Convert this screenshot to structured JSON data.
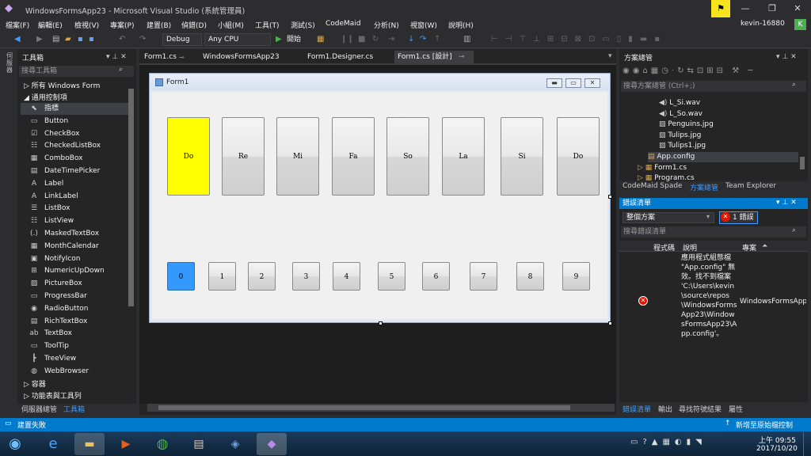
{
  "window": {
    "title": "WindowsFormsApp23 - Microsoft Visual Studio (系統管理員)",
    "user": "kevin-16880",
    "user_badge": "K"
  },
  "menu": [
    "檔案(F)",
    "編輯(E)",
    "檢視(V)",
    "專案(P)",
    "建置(B)",
    "偵錯(D)",
    "小組(M)",
    "工具(T)",
    "測試(S)",
    "CodeMaid",
    "分析(N)",
    "視窗(W)",
    "說明(H)"
  ],
  "toolbar": {
    "config": "Debug",
    "platform": "Any CPU",
    "start": "開始"
  },
  "toolbox": {
    "title": "工具箱",
    "search": "搜尋工具箱",
    "group_all": "所有 Windows Form",
    "group_common": "通用控制項",
    "items": [
      "指標",
      "Button",
      "CheckBox",
      "CheckedListBox",
      "ComboBox",
      "DateTimePicker",
      "Label",
      "LinkLabel",
      "ListBox",
      "ListView",
      "MaskedTextBox",
      "MonthCalendar",
      "NotifyIcon",
      "NumericUpDown",
      "PictureBox",
      "ProgressBar",
      "RadioButton",
      "RichTextBox",
      "TextBox",
      "ToolTip",
      "TreeView",
      "WebBrowser"
    ],
    "group_container": "容器",
    "group_menu": "功能表與工具列",
    "bottom_tabs": [
      "伺服器總管",
      "工具箱"
    ]
  },
  "doc_tabs": [
    "Form1.cs",
    "WindowsFormsApp23",
    "Form1.Designer.cs",
    "Form1.cs [設計]"
  ],
  "form": {
    "title": "Form1",
    "keys": [
      "Do",
      "Re",
      "Mi",
      "Fa",
      "So",
      "La",
      "Si",
      "Do"
    ],
    "numbers": [
      "0",
      "1",
      "2",
      "3",
      "4",
      "5",
      "6",
      "7",
      "8",
      "9"
    ]
  },
  "solution": {
    "title": "方案總管",
    "search": "搜尋方案總管 (Ctrl+;)",
    "items": [
      "L_Si.wav",
      "L_So.wav",
      "Penguins.jpg",
      "Tulips.jpg",
      "Tulips1.jpg",
      "App.config",
      "Form1.cs",
      "Program.cs"
    ],
    "tabs": [
      "CodeMaid Spade",
      "方案總管",
      "Team Explorer"
    ]
  },
  "errors": {
    "title": "錯誤清單",
    "scope": "整個方案",
    "count": "1 錯誤",
    "search": "搜尋錯誤清單",
    "col_code": "程式碼",
    "col_desc": "說明",
    "col_project": "專案",
    "desc": "應用程式組態檔 \"App.config\" 無效。找不到檔案 'C:\\Users\\kevin\\source\\repos\\WindowsFormsApp23\\WindowsFormsApp23\\App.config'。",
    "project": "WindowsFormsApp23",
    "tabs": [
      "錯誤清單",
      "輸出",
      "尋找符號結果",
      "屬性"
    ]
  },
  "status": {
    "left": "建置失敗",
    "right": "新增至原始檔控制"
  },
  "clock": {
    "time": "上午 09:55",
    "date": "2017/10/20"
  }
}
